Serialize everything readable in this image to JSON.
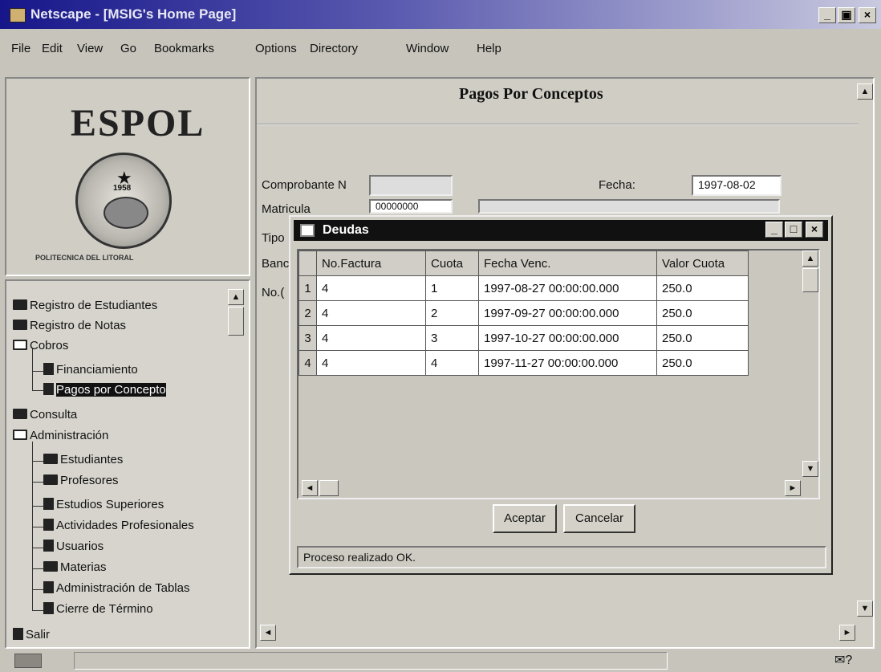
{
  "window": {
    "title": "Netscape - [MSIG's Home Page]",
    "controls": [
      "_",
      "▣",
      "×"
    ]
  },
  "menu": [
    "File",
    "Edit",
    "View",
    "Go",
    "Bookmarks",
    "Options",
    "Directory",
    "Window",
    "Help"
  ],
  "logo": {
    "text": "ESPOL",
    "year": "1958",
    "footer": "POLITECNICA DEL LITORAL"
  },
  "tree": {
    "items": [
      "Registro de Estudiantes",
      "Registro de Notas",
      "Cobros",
      "Financiamiento",
      "Pagos por Concepto",
      "Consulta",
      "Administración",
      "Estudiantes",
      "Profesores",
      "Estudios Superiores",
      "Actividades Profesionales",
      "Usuarios",
      "Materias",
      "Administración de Tablas",
      "Cierre de Término",
      "Salir"
    ]
  },
  "page": {
    "title": "Pagos Por Conceptos",
    "labels": {
      "comprobante": "Comprobante N",
      "fecha": "Fecha:",
      "matricula": "Matricula",
      "tipo": "Tipo",
      "banco": "Banc",
      "no": "No.("
    },
    "fecha_value": "1997-08-02",
    "matricula_value": "00000000"
  },
  "dialog": {
    "title": "Deudas",
    "columns": [
      "No.Factura",
      "Cuota",
      "Fecha Venc.",
      "Valor Cuota"
    ],
    "rows": [
      {
        "n": "1",
        "factura": "4",
        "cuota": "1",
        "fecha": "1997-08-27 00:00:00.000",
        "valor": "250.0"
      },
      {
        "n": "2",
        "factura": "4",
        "cuota": "2",
        "fecha": "1997-09-27 00:00:00.000",
        "valor": "250.0"
      },
      {
        "n": "3",
        "factura": "4",
        "cuota": "3",
        "fecha": "1997-10-27 00:00:00.000",
        "valor": "250.0"
      },
      {
        "n": "4",
        "factura": "4",
        "cuota": "4",
        "fecha": "1997-11-27 00:00:00.000",
        "valor": "250.0"
      }
    ],
    "accept_label": "Aceptar",
    "cancel_label": "Cancelar",
    "status": "Proceso realizado OK."
  }
}
